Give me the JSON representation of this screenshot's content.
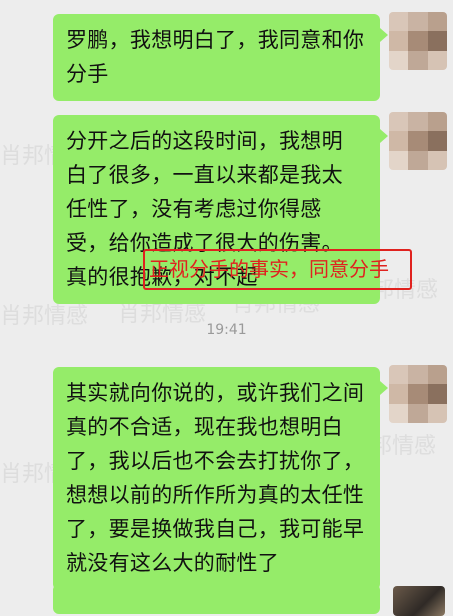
{
  "watermark_text": "肖邦情感",
  "messages": [
    {
      "text": "罗鹏，我想明白了，我同意和你分手"
    },
    {
      "text": "分开之后的这段时间，我想明白了很多，一直以来都是我太任性了，没有考虑过你得感受，给你造成了很大的伤害。真的很抱歉，对不起"
    },
    {
      "text": "其实就向你说的，或许我们之间真的不合适，现在我也想明白了，我以后也不会去打扰你了，想想以前的所作所为真的太任性了，要是换做我自己，我可能早就没有这么大的耐性了"
    }
  ],
  "timestamp": "19:41",
  "annotation": "正视分手的事实，同意分手",
  "colors": {
    "background": "#ededed",
    "bubble": "#95ec69",
    "annotation": "#e0221f",
    "timestamp": "#9a9a9a"
  }
}
